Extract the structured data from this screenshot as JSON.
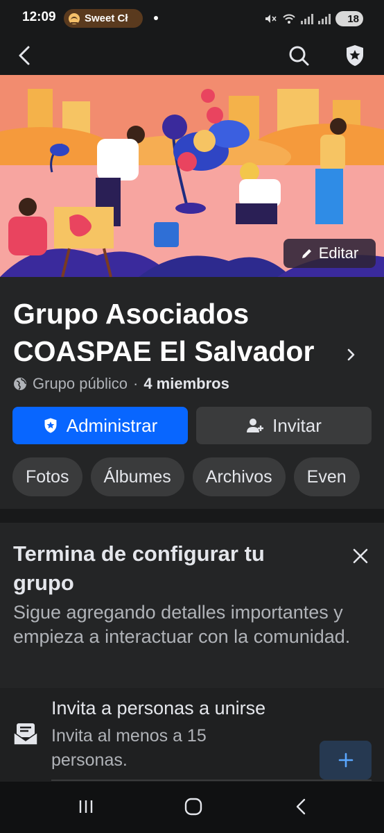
{
  "status": {
    "time": "12:09",
    "media_text": "Sweet Cł",
    "battery": "18",
    "icons": [
      "spotify-icon",
      "mute-icon",
      "wifi-icon",
      "signal-icon",
      "battery-icon"
    ]
  },
  "nav": {
    "back_icon": "back-arrow-icon",
    "search_icon": "search-icon",
    "admin_icon": "shield-star-icon"
  },
  "cover": {
    "edit_label": "Editar"
  },
  "group": {
    "name": "Grupo Asociados COASPAE El Salvador",
    "privacy": "Grupo público",
    "separator": "·",
    "members": "4 miembros",
    "admin_label": "Administrar",
    "invite_label": "Invitar",
    "tabs": [
      "Fotos",
      "Álbumes",
      "Archivos",
      "Even"
    ]
  },
  "setup": {
    "title": "Termina de configurar tu grupo",
    "subtitle": "Sigue agregando detalles importantes y empieza a interactuar con la comunidad.",
    "task_title": "Invita a personas a unirse",
    "task_subtitle": "Invita al menos a 15 personas."
  },
  "colors": {
    "accent": "#0866ff",
    "background": "#18191a",
    "card": "#242526",
    "chip": "#3a3b3c"
  }
}
